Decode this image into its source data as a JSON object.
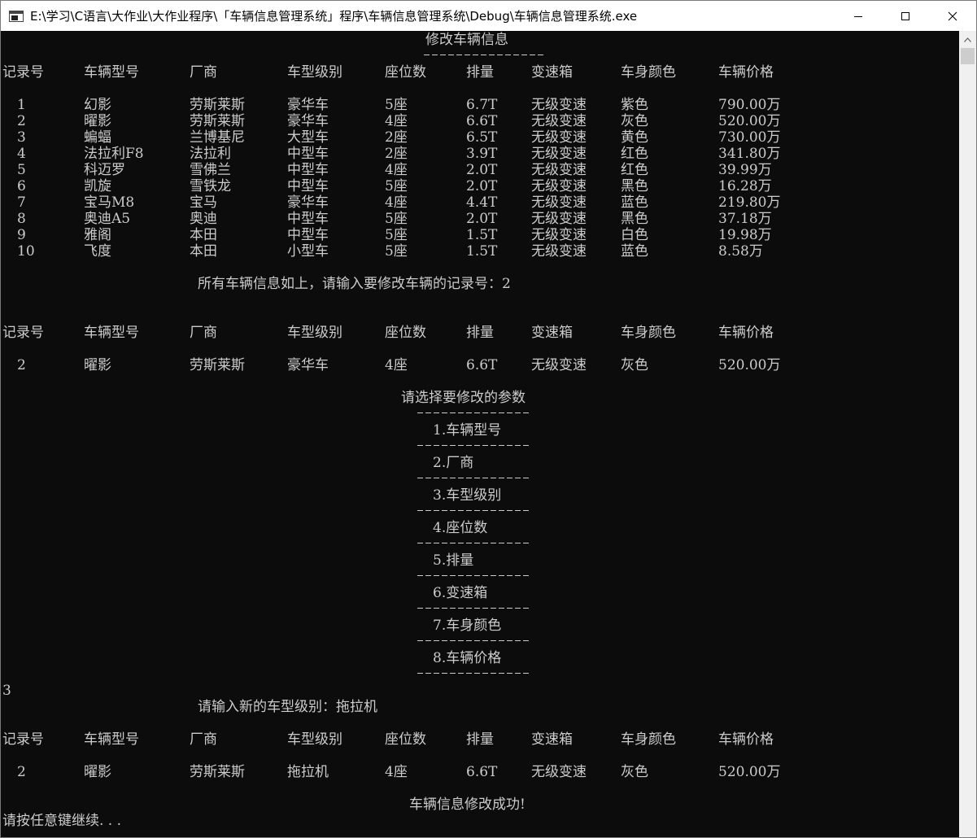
{
  "window": {
    "title": "E:\\学习\\C语言\\大作业\\大作业程序\\「车辆信息管理系统」程序\\车辆信息管理系统\\Debug\\车辆信息管理系统.exe",
    "icons": {
      "app": "console-app-icon",
      "minimize": "minimize-icon",
      "maximize": "maximize-icon",
      "close": "close-icon"
    }
  },
  "console": {
    "heading": "修改车辆信息",
    "headers": [
      "记录号",
      "车辆型号",
      "厂商",
      "车型级别",
      "座位数",
      "排量",
      "变速箱",
      "车身颜色",
      "车辆价格"
    ],
    "all_rows": [
      [
        "1",
        "幻影",
        "劳斯莱斯",
        "豪华车",
        "5座",
        "6.7T",
        "无级变速",
        "紫色",
        "790.00万"
      ],
      [
        "2",
        "曜影",
        "劳斯莱斯",
        "豪华车",
        "4座",
        "6.6T",
        "无级变速",
        "灰色",
        "520.00万"
      ],
      [
        "3",
        "蝙蝠",
        "兰博基尼",
        "大型车",
        "2座",
        "6.5T",
        "无级变速",
        "黄色",
        "730.00万"
      ],
      [
        "4",
        "法拉利F8",
        "法拉利",
        "中型车",
        "2座",
        "3.9T",
        "无级变速",
        "红色",
        "341.80万"
      ],
      [
        "5",
        "科迈罗",
        "雪佛兰",
        "中型车",
        "4座",
        "2.0T",
        "无级变速",
        "红色",
        "39.99万"
      ],
      [
        "6",
        "凯旋",
        "雪铁龙",
        "中型车",
        "5座",
        "2.0T",
        "无级变速",
        "黑色",
        "16.28万"
      ],
      [
        "7",
        "宝马M8",
        "宝马",
        "豪华车",
        "4座",
        "4.4T",
        "无级变速",
        "蓝色",
        "219.80万"
      ],
      [
        "8",
        "奥迪A5",
        "奥迪",
        "中型车",
        "5座",
        "2.0T",
        "无级变速",
        "黑色",
        "37.18万"
      ],
      [
        "9",
        "雅阁",
        "本田",
        "中型车",
        "5座",
        "1.5T",
        "无级变速",
        "白色",
        "19.98万"
      ],
      [
        "10",
        "飞度",
        "本田",
        "小型车",
        "5座",
        "1.5T",
        "无级变速",
        "蓝色",
        "8.58万"
      ]
    ],
    "prompt_record": "所有车辆信息如上，请输入要修改车辆的记录号：2",
    "selected_row": [
      "2",
      "曜影",
      "劳斯莱斯",
      "豪华车",
      "4座",
      "6.6T",
      "无级变速",
      "灰色",
      "520.00万"
    ],
    "menu_title": "请选择要修改的参数",
    "menu_items": [
      "1.车辆型号",
      "2.厂商",
      "3.车型级别",
      "4.座位数",
      "5.排量",
      "6.变速箱",
      "7.车身颜色",
      "8.车辆价格"
    ],
    "menu_choice": "3",
    "prompt_new": "请输入新的车型级别：拖拉机",
    "updated_row": [
      "2",
      "曜影",
      "劳斯莱斯",
      "拖拉机",
      "4座",
      "6.6T",
      "无级变速",
      "灰色",
      "520.00万"
    ],
    "success": "车辆信息修改成功!",
    "continue": "请按任意键继续. . ."
  }
}
